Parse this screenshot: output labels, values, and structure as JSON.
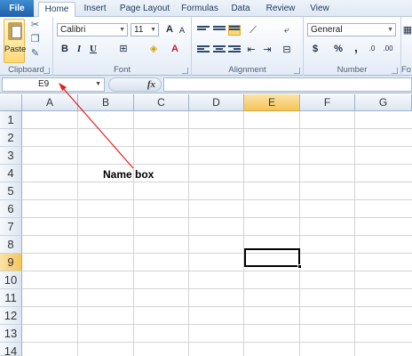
{
  "tabs": [
    {
      "label": "File"
    },
    {
      "label": "Home"
    },
    {
      "label": "Insert"
    },
    {
      "label": "Page Layout"
    },
    {
      "label": "Formulas"
    },
    {
      "label": "Data"
    },
    {
      "label": "Review"
    },
    {
      "label": "View"
    }
  ],
  "ribbon": {
    "clipboard": {
      "paste_label": "Paste",
      "group_label": "Clipboard"
    },
    "font": {
      "font_name": "Calibri",
      "font_size": "11",
      "group_label": "Font",
      "bold": "B",
      "italic": "I",
      "underline": "U"
    },
    "alignment": {
      "group_label": "Alignment"
    },
    "number": {
      "format": "General",
      "group_label": "Number",
      "currency": "$",
      "percent": "%",
      "comma": ","
    },
    "extra_label": "Fo"
  },
  "formula_bar": {
    "name_box": "E9",
    "fx": "fx",
    "formula": ""
  },
  "grid": {
    "columns": [
      "A",
      "B",
      "C",
      "D",
      "E",
      "F",
      "G"
    ],
    "rows": [
      "1",
      "2",
      "3",
      "4",
      "5",
      "6",
      "7",
      "8",
      "9",
      "10",
      "11",
      "12",
      "13",
      "14"
    ],
    "selected_cell": "E9"
  },
  "annotation": {
    "label": "Name box",
    "color": "#e0211c"
  },
  "colors": {
    "accent": "#1f5fa8",
    "selection": "#f4c55b"
  }
}
